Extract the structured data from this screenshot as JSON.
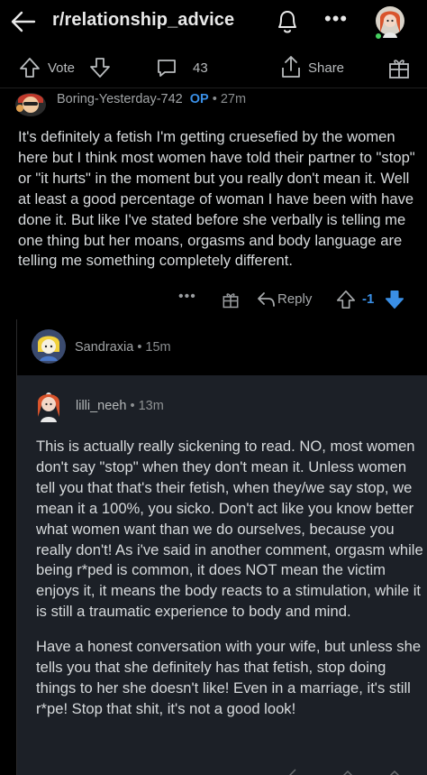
{
  "header": {
    "title": "r/relationship_advice",
    "more_label": "•••"
  },
  "post_bar": {
    "vote_label": "Vote",
    "comment_count": "43",
    "share_label": "Share"
  },
  "comment1": {
    "author": "Boring-Yesterday-742",
    "op_badge": "OP",
    "age": "• 27m",
    "body": "It's definitely a fetish I'm getting cruesefied by the women here but I think most women have told their partner to \"stop\" or \"it hurts\" in the moment but you really don't mean it. Well at least a good percentage of woman I have been with have done it. But like I've stated before she verbally is telling me one thing but her moans, orgasms and body language are telling me something completely different.",
    "more_label": "•••",
    "reply_label": "Reply",
    "score": "-1",
    "vote_state": "downvoted",
    "score_color": "#3a8fe6"
  },
  "comment2": {
    "author": "Sandraxia",
    "age": "• 15m"
  },
  "comment3": {
    "author": "lilli_neeh",
    "age": "• 13m",
    "paragraphs": [
      "This is actually really sickening to read. NO, most women don't say \"stop\" when they don't mean it. Unless women tell you that that's their fetish, when they/we say stop, we mean it a 100%, you sicko. Don't act like you know better what women want than we do ourselves, because you really don't! As i've said in another comment, orgasm while being r*ped is common, it does NOT mean the victim enjoys it, it means the body reacts to a stimulation, while it is still a traumatic experience to body and mind.",
      "Have a honest conversation with your wife, but unless she tells you that she definitely has that fetish, stop doing things to her she doesn't like! Even in a marriage, it's still r*pe! Stop that shit, it's not a good look!"
    ]
  },
  "icons": {
    "back": "arrow-left-icon",
    "notifications": "bell-icon",
    "upvote": "arrow-up-icon",
    "downvote": "arrow-down-icon",
    "comment": "speech-bubble-icon",
    "share": "share-icon",
    "award": "gift-icon",
    "reply": "reply-arrow-icon"
  },
  "colors": {
    "background": "#000000",
    "highlight_bg": "#1c2027",
    "accent_blue": "#3a8fe6",
    "online_green": "#46d160"
  }
}
